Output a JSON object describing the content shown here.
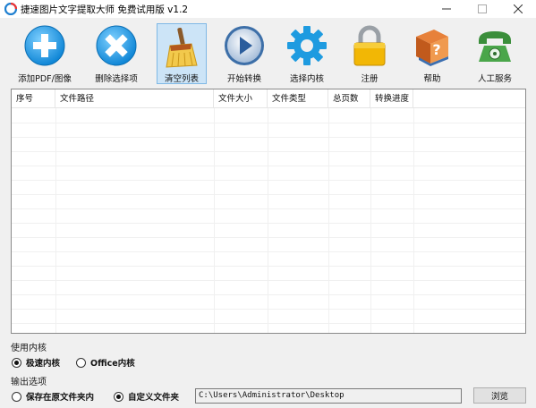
{
  "window": {
    "title": "捷速图片文字提取大师 免费试用版 v1.2"
  },
  "toolbar": {
    "items": [
      {
        "label": "添加PDF/图像",
        "icon": "add-plus-icon"
      },
      {
        "label": "删除选择项",
        "icon": "delete-x-icon"
      },
      {
        "label": "清空列表",
        "icon": "broom-icon",
        "selected": true
      },
      {
        "label": "开始转换",
        "icon": "play-icon"
      },
      {
        "label": "选择内核",
        "icon": "gear-icon"
      },
      {
        "label": "注册",
        "icon": "lock-icon"
      },
      {
        "label": "帮助",
        "icon": "help-book-icon"
      },
      {
        "label": "人工服务",
        "icon": "telephone-icon"
      }
    ]
  },
  "table": {
    "columns": [
      "序号",
      "文件路径",
      "文件大小",
      "文件类型",
      "总页数",
      "转换进度"
    ]
  },
  "engine": {
    "title": "使用内核",
    "options": [
      {
        "label": "极速内核",
        "checked": true
      },
      {
        "label": "Office内核",
        "checked": false
      }
    ]
  },
  "output": {
    "title": "输出选项",
    "options": [
      {
        "label": "保存在原文件夹内",
        "checked": false
      },
      {
        "label": "自定义文件夹",
        "checked": true
      }
    ],
    "path_value": "C:\\Users\\Administrator\\Desktop",
    "browse_label": "浏览"
  },
  "colors": {
    "accent_blue": "#1e9be0",
    "selected_bg": "#cce4f7",
    "lock_gold": "#f2b705",
    "phone_green": "#3b8e3b"
  }
}
